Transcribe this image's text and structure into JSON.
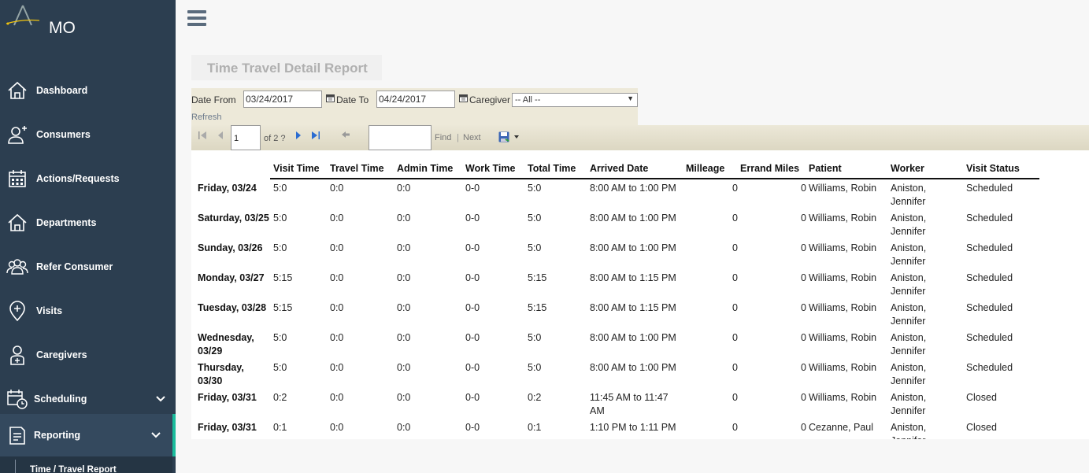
{
  "app": {
    "brand": "MO"
  },
  "sidebar": {
    "items": [
      {
        "label": "Dashboard",
        "icon": "home-icon"
      },
      {
        "label": "Consumers",
        "icon": "user-add-icon"
      },
      {
        "label": "Actions/Requests",
        "icon": "calendar-grid-icon"
      },
      {
        "label": "Departments",
        "icon": "home-icon"
      },
      {
        "label": "Refer Consumer",
        "icon": "group-icon"
      },
      {
        "label": "Visits",
        "icon": "map-pin-icon"
      },
      {
        "label": "Caregivers",
        "icon": "caregiver-icon"
      },
      {
        "label": "Scheduling",
        "icon": "calendar-clock-icon"
      },
      {
        "label": "Reporting",
        "icon": "report-icon"
      }
    ],
    "sub_item": "Time / Travel Report",
    "accent": "#1abc9c"
  },
  "report": {
    "title": "Time Travel Detail Report",
    "params": {
      "date_from_label": "Date From",
      "date_from": "03/24/2017",
      "date_to_label": "Date To",
      "date_to": "04/24/2017",
      "caregiver_label": "Caregiver",
      "caregiver": "-- All --",
      "refresh": "Refresh"
    },
    "toolbar": {
      "page": "1",
      "of_pages": "of 2 ?",
      "find": "Find",
      "separator": "|",
      "next": "Next"
    },
    "columns": [
      "Visit Time",
      "Travel Time",
      "Admin Time",
      "Work Time",
      "Total Time",
      "Arrived Date",
      "Milleage",
      "Errand Miles",
      "Patient",
      "Worker",
      "Visit Status"
    ],
    "rows": [
      {
        "day": "Friday, 03/24",
        "visit": "5:0",
        "travel": "0:0",
        "admin": "0:0",
        "work": "0-0",
        "total": "5:0",
        "arrived": "8:00 AM to 1:00 PM",
        "milleage": "0",
        "errand": "0",
        "patient": "Williams, Robin",
        "worker": "Aniston, Jennifer",
        "status": "Scheduled"
      },
      {
        "day": "Saturday, 03/25",
        "visit": "5:0",
        "travel": "0:0",
        "admin": "0:0",
        "work": "0-0",
        "total": "5:0",
        "arrived": "8:00 AM to 1:00 PM",
        "milleage": "0",
        "errand": "0",
        "patient": "Williams, Robin",
        "worker": "Aniston, Jennifer",
        "status": "Scheduled"
      },
      {
        "day": "Sunday, 03/26",
        "visit": "5:0",
        "travel": "0:0",
        "admin": "0:0",
        "work": "0-0",
        "total": "5:0",
        "arrived": "8:00 AM to 1:00 PM",
        "milleage": "0",
        "errand": "0",
        "patient": "Williams, Robin",
        "worker": "Aniston, Jennifer",
        "status": "Scheduled"
      },
      {
        "day": "Monday, 03/27",
        "visit": "5:15",
        "travel": "0:0",
        "admin": "0:0",
        "work": "0-0",
        "total": "5:15",
        "arrived": "8:00 AM to 1:15 PM",
        "milleage": "0",
        "errand": "0",
        "patient": "Williams, Robin",
        "worker": "Aniston, Jennifer",
        "status": "Scheduled"
      },
      {
        "day": "Tuesday, 03/28",
        "visit": "5:15",
        "travel": "0:0",
        "admin": "0:0",
        "work": "0-0",
        "total": "5:15",
        "arrived": "8:00 AM to 1:15 PM",
        "milleage": "0",
        "errand": "0",
        "patient": "Williams, Robin",
        "worker": "Aniston, Jennifer",
        "status": "Scheduled"
      },
      {
        "day": "Wednesday, 03/29",
        "visit": "5:0",
        "travel": "0:0",
        "admin": "0:0",
        "work": "0-0",
        "total": "5:0",
        "arrived": "8:00 AM to 1:00 PM",
        "milleage": "0",
        "errand": "0",
        "patient": "Williams, Robin",
        "worker": "Aniston, Jennifer",
        "status": "Scheduled"
      },
      {
        "day": "Thursday, 03/30",
        "visit": "5:0",
        "travel": "0:0",
        "admin": "0:0",
        "work": "0-0",
        "total": "5:0",
        "arrived": "8:00 AM to 1:00 PM",
        "milleage": "0",
        "errand": "0",
        "patient": "Williams, Robin",
        "worker": "Aniston, Jennifer",
        "status": "Scheduled"
      },
      {
        "day": "Friday, 03/31",
        "visit": "0:2",
        "travel": "0:0",
        "admin": "0:0",
        "work": "0-0",
        "total": "0:2",
        "arrived": "11:45 AM to 11:47 AM",
        "milleage": "0",
        "errand": "0",
        "patient": "Williams, Robin",
        "worker": "Aniston, Jennifer",
        "status": "Closed"
      },
      {
        "day": "Friday, 03/31",
        "visit": "0:1",
        "travel": "0:0",
        "admin": "0:0",
        "work": "0-0",
        "total": "0:1",
        "arrived": "1:10 PM to 1:11 PM",
        "milleage": "0",
        "errand": "0",
        "patient": "Cezanne, Paul",
        "worker": "Aniston, Jennifer",
        "status": "Closed"
      }
    ]
  }
}
